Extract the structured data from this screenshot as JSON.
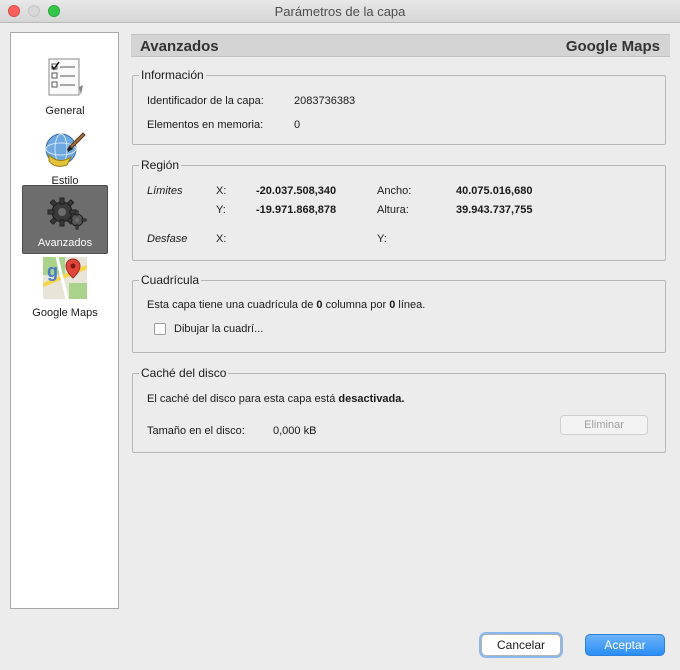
{
  "window": {
    "title": "Parámetros de la capa"
  },
  "sidebar": {
    "items": [
      {
        "label": "General",
        "icon": "checklist-icon"
      },
      {
        "label": "Estilo",
        "icon": "paint-globe-icon"
      },
      {
        "label": "Avanzados",
        "icon": "gears-icon",
        "selected": true
      },
      {
        "label": "Google Maps",
        "icon": "google-maps-icon"
      }
    ]
  },
  "header": {
    "left": "Avanzados",
    "right": "Google Maps"
  },
  "info": {
    "title": "Información",
    "id_label": "Identificador de la capa:",
    "id_value": "2083736383",
    "mem_label": "Elementos en memoria:",
    "mem_value": "0"
  },
  "region": {
    "title": "Región",
    "limits_label": "Límites",
    "x_label": "X:",
    "x_value": "-20.037.508,340",
    "y_label": "Y:",
    "y_value": "-19.971.868,878",
    "width_label": "Ancho:",
    "width_value": "40.075.016,680",
    "height_label": "Altura:",
    "height_value": "39.943.737,755",
    "offset_label": "Desfase",
    "offset_x_label": "X:",
    "offset_y_label": "Y:"
  },
  "grid": {
    "title": "Cuadrícula",
    "text_pre": "Esta capa tiene una cuadrícula de ",
    "columns": "0",
    "text_mid": " columna por ",
    "rows": "0",
    "text_post": " línea.",
    "checkbox_label": "Dibujar la cuadrí...",
    "checked": false
  },
  "cache": {
    "title": "Caché del disco",
    "text_pre": "El caché del disco para esta capa está ",
    "status": "desactivada.",
    "size_label": "Tamaño en el disco:",
    "size_value": "0,000 kB",
    "delete_label": "Eliminar"
  },
  "footer": {
    "cancel_label": "Cancelar",
    "ok_label": "Aceptar"
  },
  "colors": {
    "accent": "#2a8ef6",
    "selected_bg": "#6d6d6d"
  }
}
